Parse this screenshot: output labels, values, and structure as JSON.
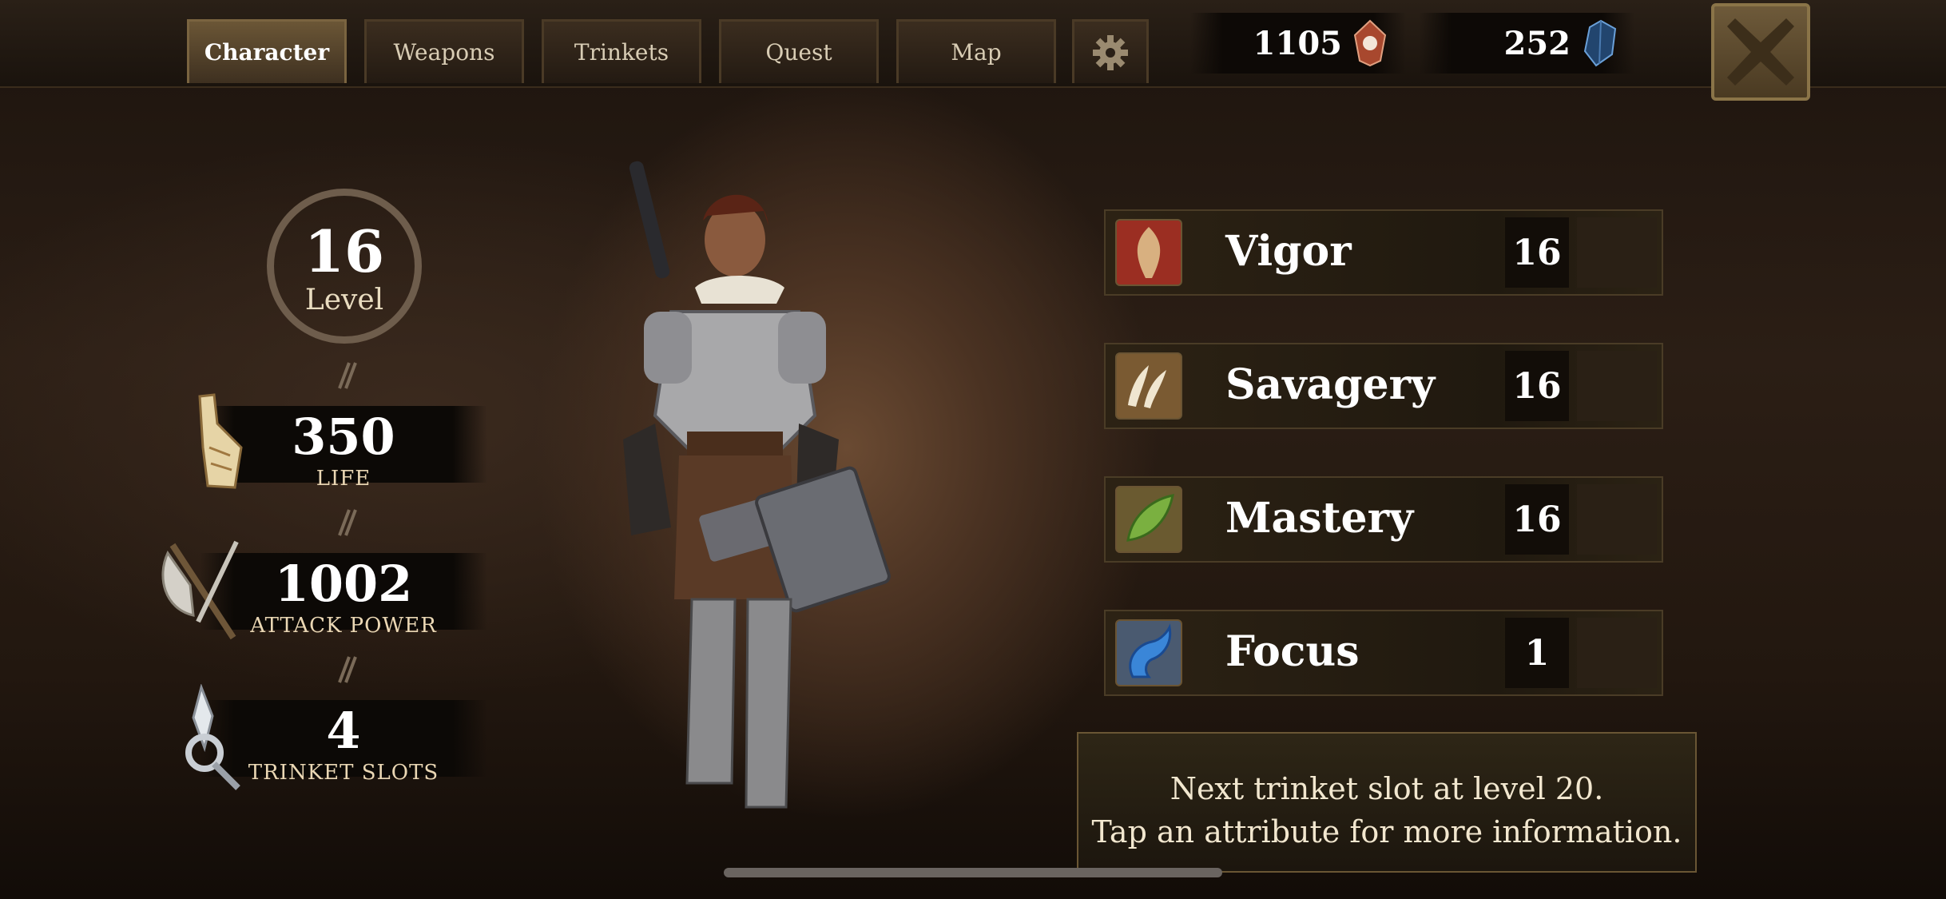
{
  "tabs": [
    {
      "label": "Character",
      "active": true
    },
    {
      "label": "Weapons",
      "active": false
    },
    {
      "label": "Trinkets",
      "active": false
    },
    {
      "label": "Quest",
      "active": false
    },
    {
      "label": "Map",
      "active": false
    }
  ],
  "settings_icon": "gear-icon",
  "currencies": [
    {
      "value": "1105",
      "icon": "soul-gem-icon",
      "color": "#b55a3a"
    },
    {
      "value": "252",
      "icon": "blue-crystal-icon",
      "color": "#2d5b8c"
    }
  ],
  "close_icon": "close-icon",
  "level": {
    "value": "16",
    "label": "Level"
  },
  "stats": [
    {
      "value": "350",
      "label": "LIFE",
      "icon": "scroll-icon"
    },
    {
      "value": "1002",
      "label": "ATTACK POWER",
      "icon": "axe-icon"
    },
    {
      "value": "4",
      "label": "TRINKET SLOTS",
      "icon": "amulet-icon"
    }
  ],
  "attributes": [
    {
      "name": "Vigor",
      "value": "16",
      "icon": "vigor-icon",
      "color": "#9b2e22"
    },
    {
      "name": "Savagery",
      "value": "16",
      "icon": "claw-icon",
      "color": "#7a5a32"
    },
    {
      "name": "Mastery",
      "value": "16",
      "icon": "leaf-icon",
      "color": "#4e7a2c"
    },
    {
      "name": "Focus",
      "value": "1",
      "icon": "blue-dragon-icon",
      "color": "#2e5ea6"
    }
  ],
  "info": {
    "line1": "Next trinket slot at level 20.",
    "line2": "Tap an attribute for more information."
  }
}
